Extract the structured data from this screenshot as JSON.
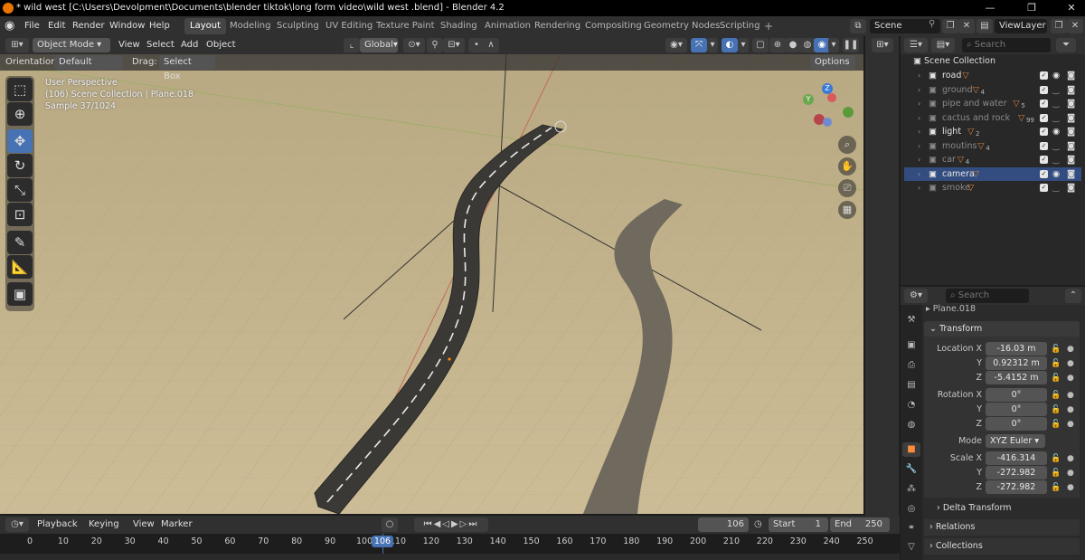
{
  "window": {
    "title": "* wild west  [C:\\Users\\Devolpment\\Documents\\blender tiktok\\long form video\\wild west .blend] - Blender 4.2",
    "minimize": "—",
    "maximize": "❐",
    "close": "✕"
  },
  "menu": [
    "File",
    "Edit",
    "Render",
    "Window",
    "Help"
  ],
  "workspaces": [
    "Layout",
    "Modeling",
    "Sculpting",
    "UV Editing",
    "Texture Paint",
    "Shading",
    "Animation",
    "Rendering",
    "Compositing",
    "Geometry Nodes",
    "Scripting"
  ],
  "workspace_add": "+",
  "scene": {
    "name": "Scene",
    "view_layer": "ViewLayer"
  },
  "viewport_header": {
    "mode": "Object Mode",
    "menus": [
      "View",
      "Select",
      "Add",
      "Object"
    ],
    "transform": "Global"
  },
  "tool_settings": {
    "orientation_label": "Orientation:",
    "orientation": "Default",
    "drag_label": "Drag:",
    "drag": "Select Box",
    "options": "Options"
  },
  "overlay_text": {
    "line1": "User Perspective",
    "line2": "(106) Scene Collection | Plane.018",
    "line3": "Sample 37/1024"
  },
  "gizmo": {
    "x": "X",
    "y": "Y",
    "z": "Z"
  },
  "outliner": {
    "search_placeholder": "Search",
    "root": "Scene Collection",
    "items": [
      {
        "name": "road",
        "badge": "",
        "enabled": true
      },
      {
        "name": "ground",
        "badge": "4",
        "enabled": false
      },
      {
        "name": "pipe and water",
        "badge": "5",
        "enabled": false
      },
      {
        "name": "cactus and rock",
        "badge": "99",
        "enabled": false
      },
      {
        "name": "light",
        "badge": "2",
        "enabled": true
      },
      {
        "name": "moutins",
        "badge": "4",
        "enabled": false
      },
      {
        "name": "car",
        "badge": "4",
        "enabled": false
      },
      {
        "name": "camera",
        "badge": "",
        "enabled": true
      },
      {
        "name": "smoke",
        "badge": "",
        "enabled": false
      }
    ]
  },
  "properties": {
    "search_placeholder": "Search",
    "object_name": "Plane.018",
    "transform_title": "Transform",
    "location": {
      "label": "Location X",
      "y_label": "Y",
      "z_label": "Z",
      "x": "-16.03 m",
      "y": "0.92312 m",
      "z": "-5.4152 m"
    },
    "rotation": {
      "label": "Rotation X",
      "y_label": "Y",
      "z_label": "Z",
      "x": "0°",
      "y": "0°",
      "z": "0°"
    },
    "mode": {
      "label": "Mode",
      "value": "XYZ Euler"
    },
    "scale": {
      "label": "Scale X",
      "y_label": "Y",
      "z_label": "Z",
      "x": "-416.314",
      "y": "-272.982",
      "z": "-272.982"
    },
    "delta_transform": "Delta Transform",
    "relations": "Relations",
    "collections": "Collections"
  },
  "timeline": {
    "menus": [
      "Playback",
      "Keying",
      "View",
      "Marker"
    ],
    "current_frame": "106",
    "start_label": "Start",
    "start": "1",
    "end_label": "End",
    "end": "250",
    "ruler": [
      "0",
      "10",
      "20",
      "30",
      "40",
      "50",
      "60",
      "70",
      "80",
      "90",
      "100",
      "110",
      "120",
      "130",
      "140",
      "150",
      "160",
      "170",
      "180",
      "190",
      "200",
      "210",
      "220",
      "230",
      "240",
      "250"
    ]
  },
  "colors": {
    "accent": "#4772b3",
    "viewport_bg": "#c2b28d",
    "road": "#3a3936",
    "selected_row": "#334d80"
  }
}
